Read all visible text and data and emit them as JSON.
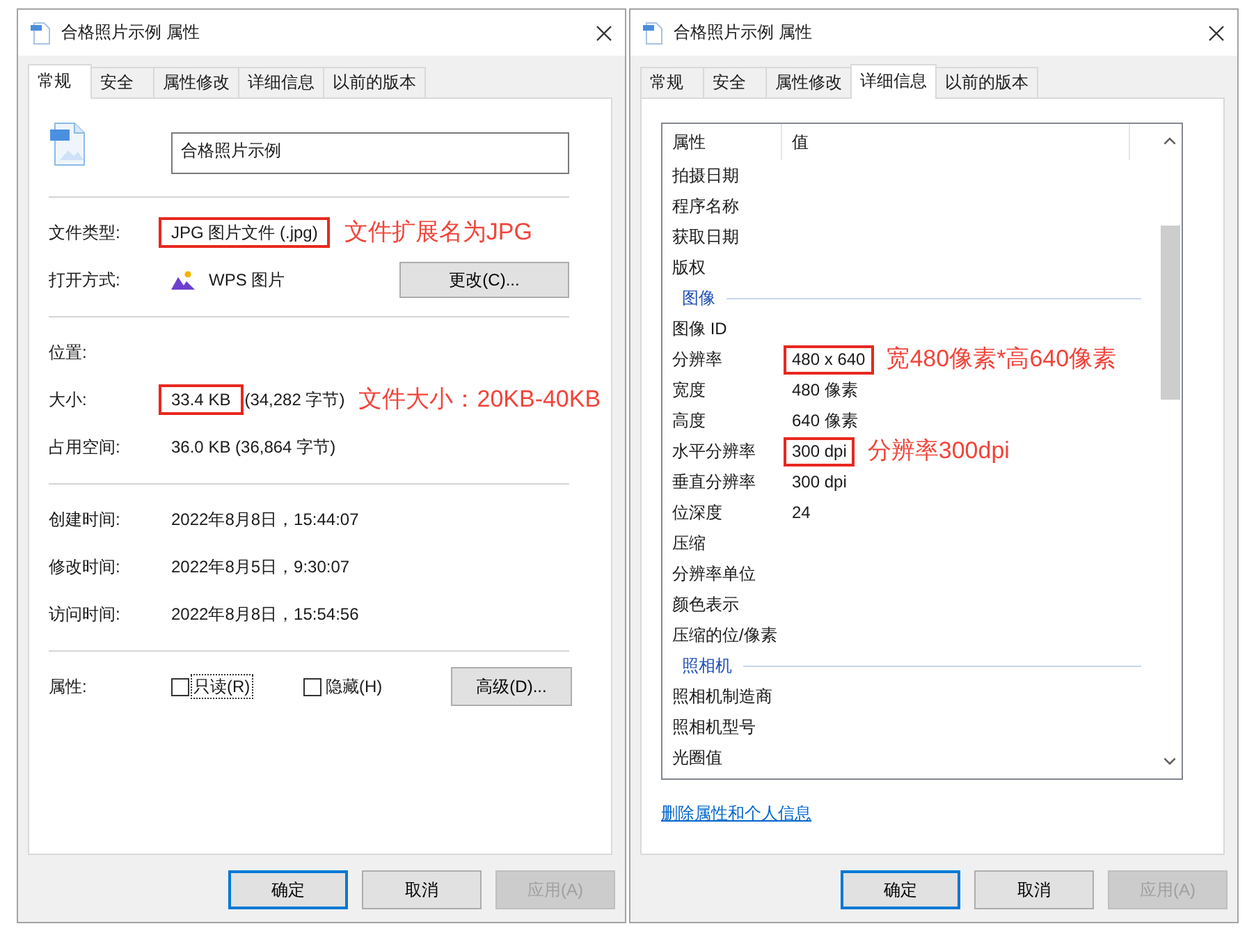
{
  "windows": [
    {
      "kind": "general",
      "title": "合格照片示例 属性",
      "tabs": [
        {
          "label": "常规",
          "selected": true
        },
        {
          "label": "安全",
          "selected": false
        },
        {
          "label": "属性修改",
          "selected": false
        },
        {
          "label": "详细信息",
          "selected": false
        },
        {
          "label": "以前的版本",
          "selected": false
        }
      ],
      "name_field": {
        "value": "合格照片示例"
      },
      "sections": [
        {
          "rows": [
            {
              "kind": "text",
              "label": "文件类型:",
              "value": "JPG 图片文件 (.jpg)",
              "highlighted": true,
              "note": "文件扩展名为JPG"
            },
            {
              "kind": "app",
              "label": "打开方式:",
              "value": "WPS 图片",
              "highlighted": false,
              "button": "更改(C)..."
            }
          ]
        },
        {
          "rows": [
            {
              "kind": "text",
              "label": "位置:",
              "highlighted": false
            },
            {
              "kind": "text",
              "label": "大小:",
              "value": "33.4 KB",
              "detail": "(34,282 字节)",
              "highlighted": true,
              "note": "文件大小：20KB-40KB"
            },
            {
              "kind": "text",
              "label": "占用空间:",
              "value": "36.0 KB (36,864 字节)",
              "highlighted": false
            }
          ]
        },
        {
          "rows": [
            {
              "kind": "text",
              "label": "创建时间:",
              "value": "2022年8月8日，15:44:07",
              "highlighted": false
            },
            {
              "kind": "text",
              "label": "修改时间:",
              "value": "2022年8月5日，9:30:07",
              "highlighted": false
            },
            {
              "kind": "text",
              "label": "访问时间:",
              "value": "2022年8月8日，15:54:56",
              "highlighted": false
            }
          ]
        },
        {
          "rows": [
            {
              "kind": "attributes",
              "label": "属性:",
              "checkboxes": [
                {
                  "label": "只读(R)",
                  "checked": false,
                  "focused": true
                },
                {
                  "label": "隐藏(H)",
                  "checked": false,
                  "focused": false
                }
              ],
              "button": "高级(D)..."
            }
          ]
        }
      ],
      "buttons": [
        {
          "label": "确定",
          "default": true,
          "disabled": false
        },
        {
          "label": "取消",
          "default": false,
          "disabled": false
        },
        {
          "label": "应用(A)",
          "default": false,
          "disabled": true
        }
      ]
    },
    {
      "kind": "details",
      "title": "合格照片示例 属性",
      "tabs": [
        {
          "label": "常规",
          "selected": false
        },
        {
          "label": "安全",
          "selected": false
        },
        {
          "label": "属性修改",
          "selected": false
        },
        {
          "label": "详细信息",
          "selected": true
        },
        {
          "label": "以前的版本",
          "selected": false
        }
      ],
      "property_list": {
        "columns": [
          "属性",
          "值"
        ],
        "rows": [
          {
            "kind": "property",
            "name": "拍摄日期",
            "highlighted": false
          },
          {
            "kind": "property",
            "name": "程序名称",
            "highlighted": false
          },
          {
            "kind": "property",
            "name": "获取日期",
            "highlighted": false
          },
          {
            "kind": "property",
            "name": "版权",
            "highlighted": false
          },
          {
            "kind": "group",
            "name": "图像"
          },
          {
            "kind": "property",
            "name": "图像 ID",
            "highlighted": false
          },
          {
            "kind": "property",
            "name": "分辨率",
            "value": "480 x 640",
            "highlighted": true,
            "note": "宽480像素*高640像素"
          },
          {
            "kind": "property",
            "name": "宽度",
            "value": "480 像素",
            "highlighted": false
          },
          {
            "kind": "property",
            "name": "高度",
            "value": "640 像素",
            "highlighted": false
          },
          {
            "kind": "property",
            "name": "水平分辨率",
            "value": "300 dpi",
            "highlighted": true,
            "note": "分辨率300dpi"
          },
          {
            "kind": "property",
            "name": "垂直分辨率",
            "value": "300 dpi",
            "highlighted": false
          },
          {
            "kind": "property",
            "name": "位深度",
            "value": "24",
            "highlighted": false
          },
          {
            "kind": "property",
            "name": "压缩",
            "highlighted": false
          },
          {
            "kind": "property",
            "name": "分辨率单位",
            "highlighted": false
          },
          {
            "kind": "property",
            "name": "颜色表示",
            "highlighted": false
          },
          {
            "kind": "property",
            "name": "压缩的位/像素",
            "highlighted": false
          },
          {
            "kind": "group",
            "name": "照相机"
          },
          {
            "kind": "property",
            "name": "照相机制造商",
            "highlighted": false
          },
          {
            "kind": "property",
            "name": "照相机型号",
            "highlighted": false
          },
          {
            "kind": "property",
            "name": "光圈值",
            "highlighted": false
          }
        ]
      },
      "link": "删除属性和个人信息",
      "buttons": [
        {
          "label": "确定",
          "default": true,
          "disabled": false
        },
        {
          "label": "取消",
          "default": false,
          "disabled": false
        },
        {
          "label": "应用(A)",
          "default": false,
          "disabled": true
        }
      ]
    }
  ]
}
